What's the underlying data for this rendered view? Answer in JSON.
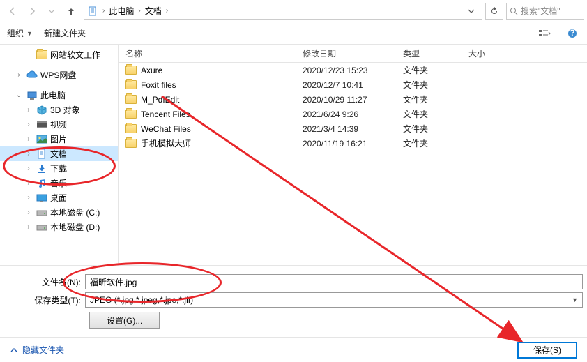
{
  "breadcrumb": {
    "seg1": "此电脑",
    "seg2": "文档"
  },
  "search": {
    "placeholder": "搜索\"文档\""
  },
  "toolbar": {
    "organize": "组织",
    "newfolder": "新建文件夹"
  },
  "columns": {
    "name": "名称",
    "date": "修改日期",
    "type": "类型",
    "size": "大小"
  },
  "sidebar": {
    "items": [
      {
        "label": "网站软文工作",
        "icon": "folder",
        "twist": "",
        "indent": 2
      },
      {
        "label": "WPS网盘",
        "icon": "cloud",
        "twist": ">",
        "indent": 1
      },
      {
        "label": "此电脑",
        "icon": "pc",
        "twist": "v",
        "indent": 1
      },
      {
        "label": "3D 对象",
        "icon": "3d",
        "twist": ">",
        "indent": 2
      },
      {
        "label": "视频",
        "icon": "video",
        "twist": ">",
        "indent": 2
      },
      {
        "label": "图片",
        "icon": "pic",
        "twist": ">",
        "indent": 2
      },
      {
        "label": "文档",
        "icon": "doc",
        "twist": ">",
        "indent": 2,
        "selected": true
      },
      {
        "label": "下载",
        "icon": "dl",
        "twist": ">",
        "indent": 2
      },
      {
        "label": "音乐",
        "icon": "music",
        "twist": ">",
        "indent": 2
      },
      {
        "label": "桌面",
        "icon": "desk",
        "twist": ">",
        "indent": 2
      },
      {
        "label": "本地磁盘 (C:)",
        "icon": "disk",
        "twist": ">",
        "indent": 2
      },
      {
        "label": "本地磁盘 (D:)",
        "icon": "disk",
        "twist": ">",
        "indent": 2
      }
    ]
  },
  "files": [
    {
      "name": "Axure",
      "date": "2020/12/23 15:23",
      "type": "文件夹"
    },
    {
      "name": "Foxit files",
      "date": "2020/12/7 10:41",
      "type": "文件夹"
    },
    {
      "name": "M_PdfEdit",
      "date": "2020/10/29 11:27",
      "type": "文件夹"
    },
    {
      "name": "Tencent Files",
      "date": "2021/6/24 9:26",
      "type": "文件夹"
    },
    {
      "name": "WeChat Files",
      "date": "2021/3/4 14:39",
      "type": "文件夹"
    },
    {
      "name": "手机模拟大师",
      "date": "2020/11/19 16:21",
      "type": "文件夹"
    }
  ],
  "form": {
    "filename_label": "文件名(N):",
    "filename_value": "福昕软件.jpg",
    "savetype_label": "保存类型(T):",
    "savetype_value": "JPEG (*.jpg,*.jpeg,*.jpe,*.jif)",
    "settings_label": "设置(G)..."
  },
  "footer": {
    "hide_folders": "隐藏文件夹",
    "save": "保存(S)"
  }
}
